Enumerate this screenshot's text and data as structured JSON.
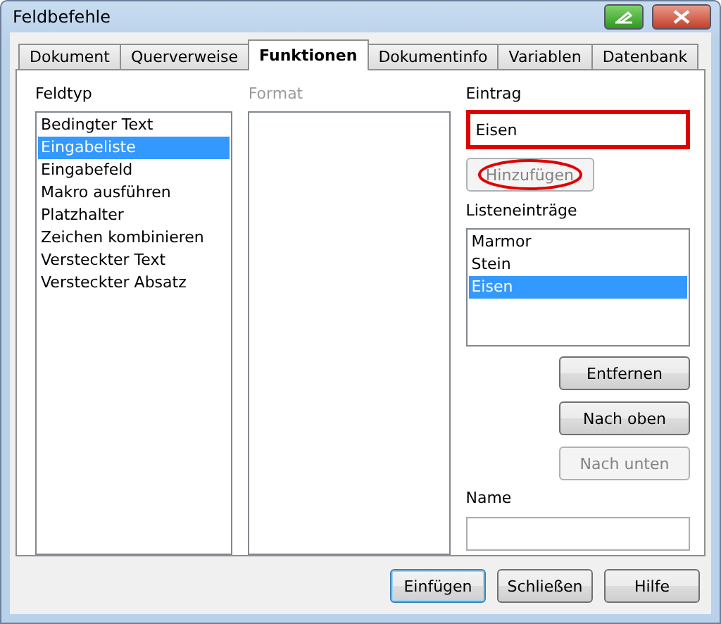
{
  "window": {
    "title": "Feldbefehle"
  },
  "tabs": [
    {
      "label": "Dokument",
      "selected": false
    },
    {
      "label": "Querverweise",
      "selected": false
    },
    {
      "label": "Funktionen",
      "selected": true
    },
    {
      "label": "Dokumentinfo",
      "selected": false
    },
    {
      "label": "Variablen",
      "selected": false
    },
    {
      "label": "Datenbank",
      "selected": false
    }
  ],
  "field_type": {
    "label": "Feldtyp",
    "items": [
      {
        "label": "Bedingter Text",
        "selected": false
      },
      {
        "label": "Eingabeliste",
        "selected": true
      },
      {
        "label": "Eingabefeld",
        "selected": false
      },
      {
        "label": "Makro ausführen",
        "selected": false
      },
      {
        "label": "Platzhalter",
        "selected": false
      },
      {
        "label": "Zeichen kombinieren",
        "selected": false
      },
      {
        "label": "Versteckter Text",
        "selected": false
      },
      {
        "label": "Versteckter Absatz",
        "selected": false
      }
    ]
  },
  "format": {
    "label": "Format",
    "disabled": true
  },
  "entry": {
    "label": "Eintrag",
    "value": "Eisen",
    "highlighted": true
  },
  "add_button": {
    "label": "Hinzufügen",
    "disabled": true,
    "circled": true
  },
  "list_entries": {
    "label": "Listeneinträge",
    "items": [
      {
        "label": "Marmor",
        "selected": false
      },
      {
        "label": "Stein",
        "selected": false
      },
      {
        "label": "Eisen",
        "selected": true
      }
    ]
  },
  "side_buttons": [
    {
      "label": "Entfernen",
      "disabled": false
    },
    {
      "label": "Nach oben",
      "disabled": false
    },
    {
      "label": "Nach unten",
      "disabled": true
    }
  ],
  "name": {
    "label": "Name"
  },
  "footer_buttons": [
    {
      "label": "Einfügen",
      "default": true
    },
    {
      "label": "Schließen",
      "default": false
    },
    {
      "label": "Hilfe",
      "default": false
    }
  ]
}
